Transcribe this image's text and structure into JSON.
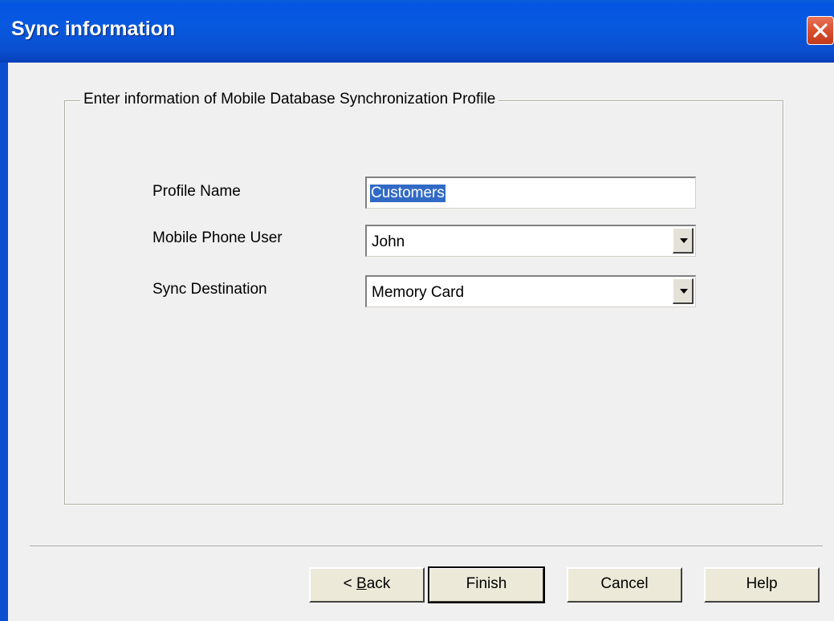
{
  "window": {
    "title": "Sync information",
    "colors": {
      "titlebar": "#0a4fd0",
      "close_button": "#d9502f",
      "selection": "#316ac5",
      "face": "#f0f0f0"
    }
  },
  "group": {
    "legend": "Enter information of Mobile  Database Synchronization Profile"
  },
  "form": {
    "profile_name": {
      "label": "Profile Name",
      "value": "Customers"
    },
    "mobile_phone_user": {
      "label": "Mobile Phone User",
      "value": "John"
    },
    "sync_destination": {
      "label": "Sync Destination",
      "value": "Memory Card"
    }
  },
  "buttons": {
    "back_prefix": "< ",
    "back_accel": "B",
    "back_rest": "ack",
    "finish": "Finish",
    "cancel": "Cancel",
    "help": "Help"
  },
  "icons": {
    "close": "close-icon",
    "dropdown": "chevron-down-icon"
  }
}
